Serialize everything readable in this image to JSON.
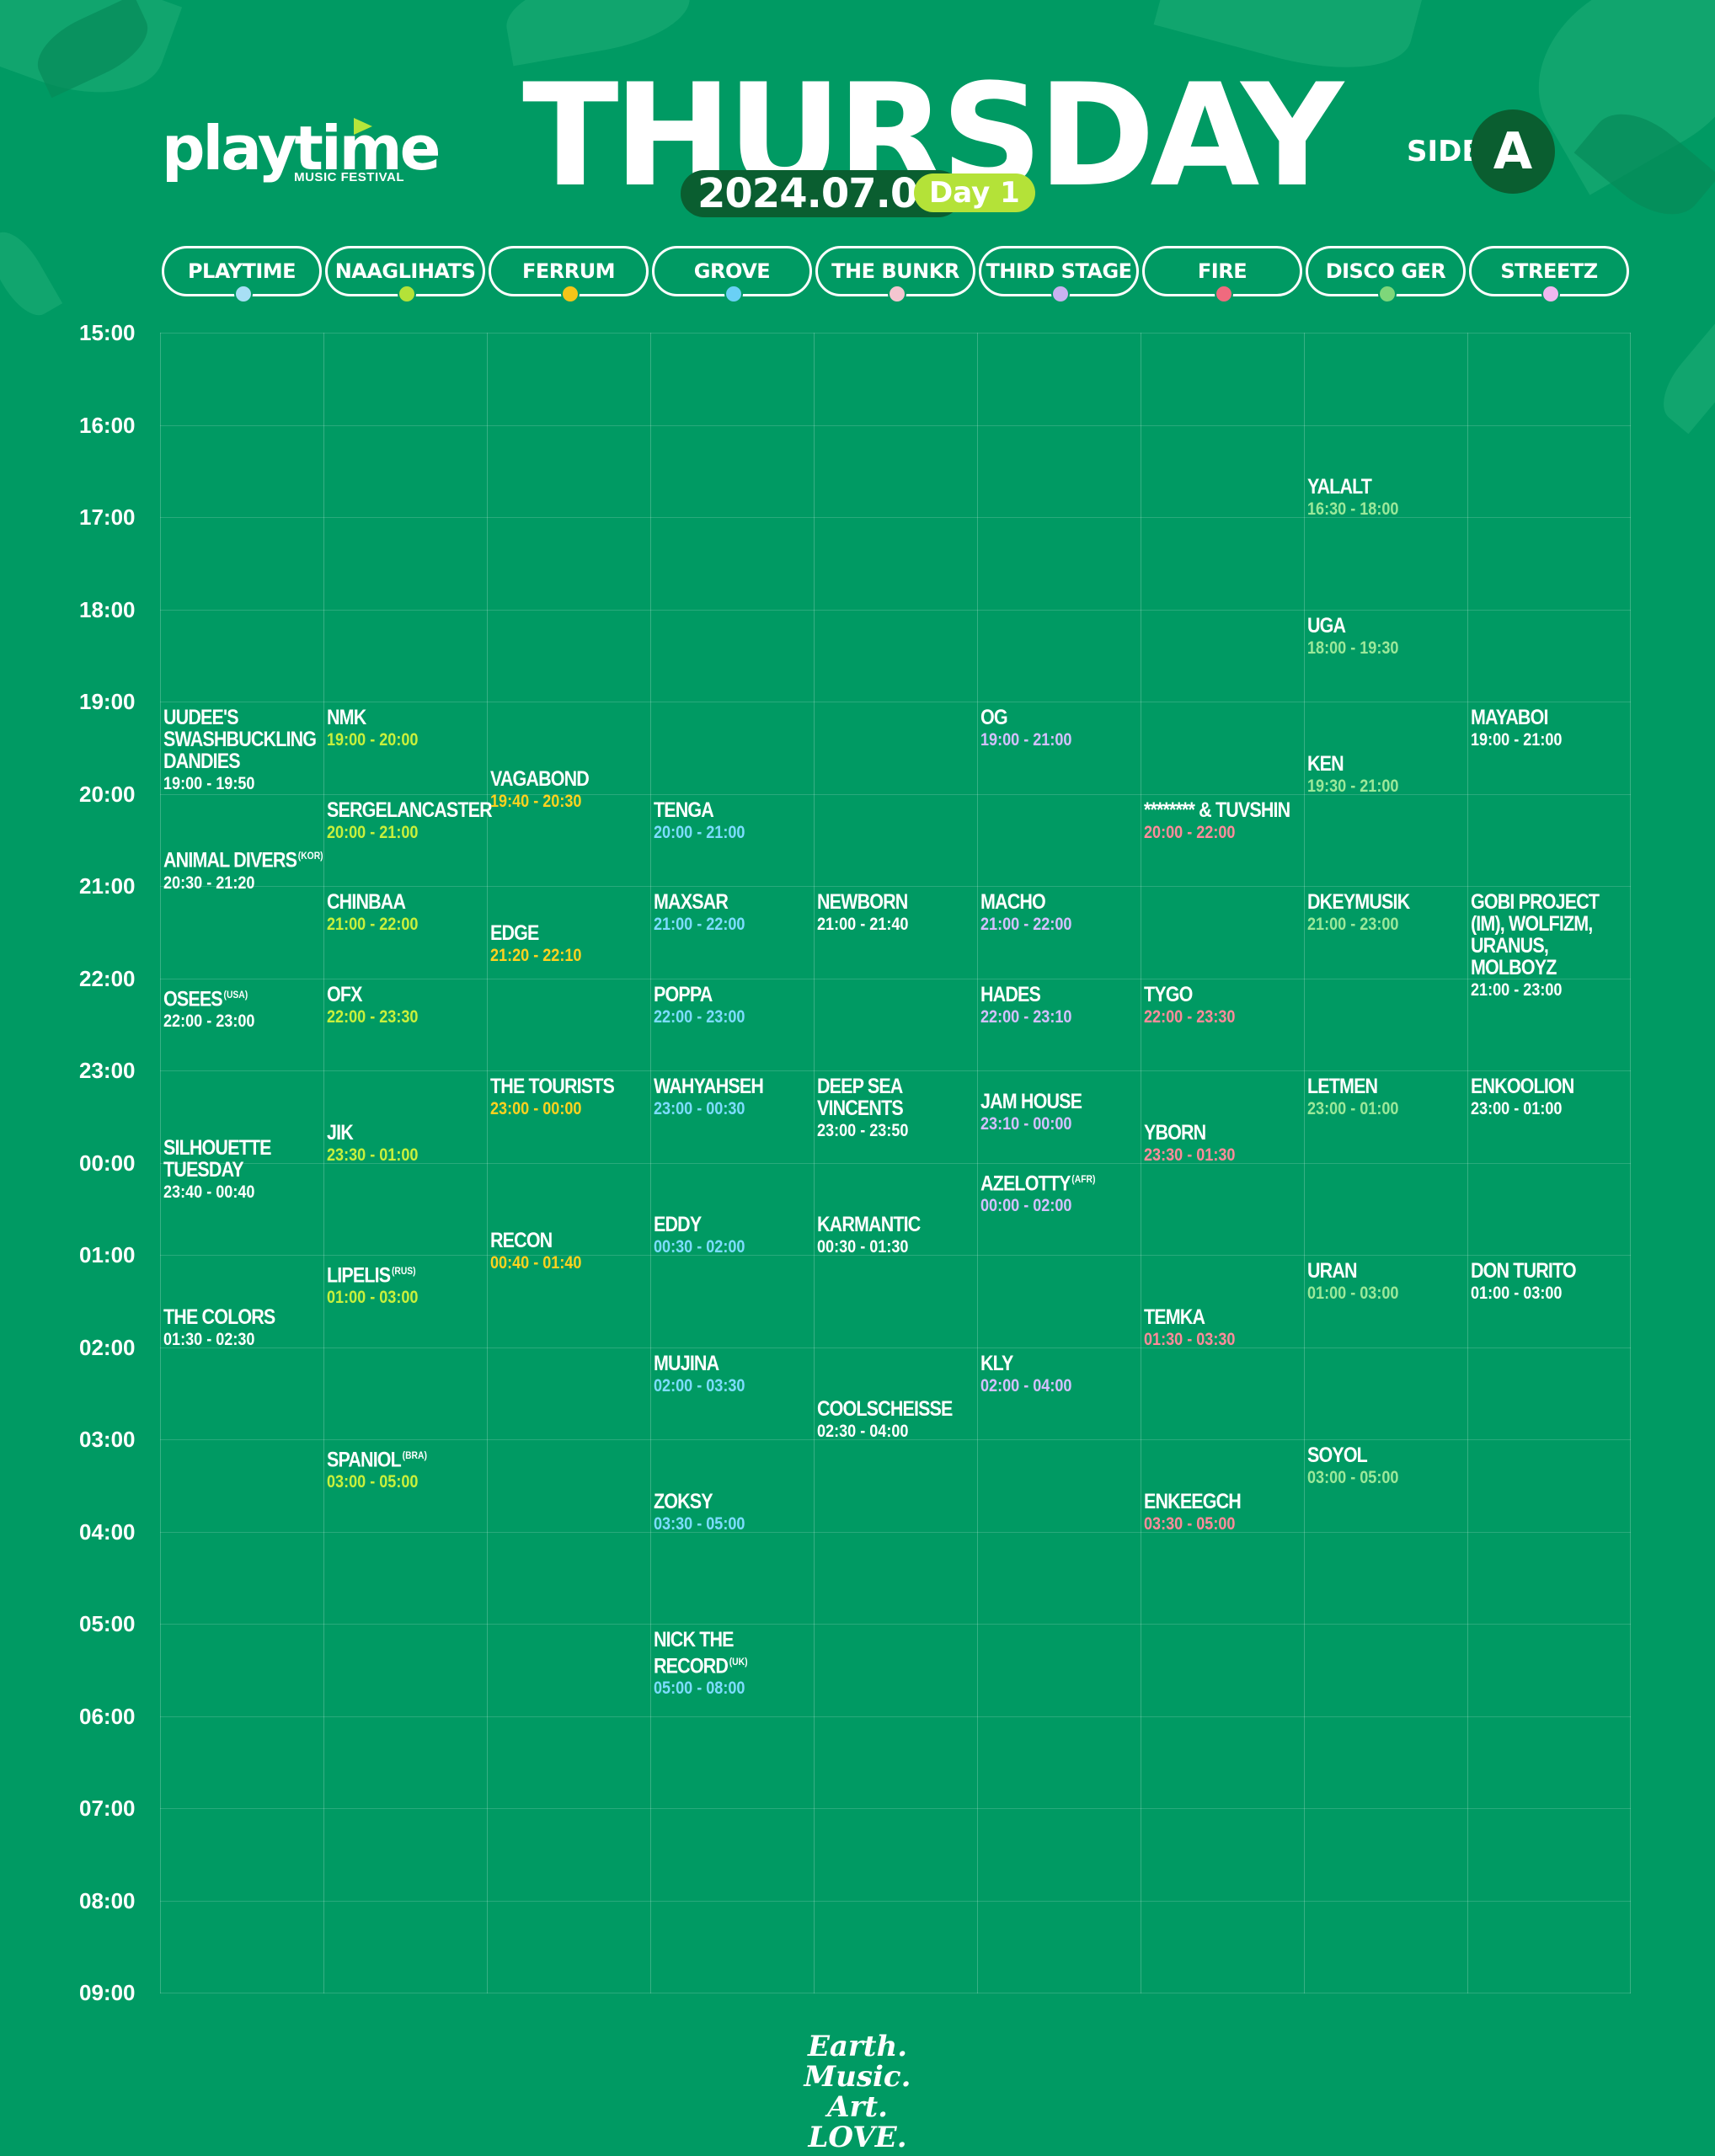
{
  "brand": {
    "logo_text": "playtime",
    "logo_sub": "MUSIC FESTIVAL"
  },
  "header": {
    "day": "THURSDAY",
    "date": "2024.07.04",
    "day_label": "Day 1",
    "side_label": "SIDE",
    "side_value": "A"
  },
  "colors": {
    "background": "#009a63",
    "accent_dark": "#0a5e30",
    "accent_lime": "#b4e238"
  },
  "times": [
    "15:00",
    "16:00",
    "17:00",
    "18:00",
    "19:00",
    "20:00",
    "21:00",
    "22:00",
    "23:00",
    "00:00",
    "01:00",
    "02:00",
    "03:00",
    "04:00",
    "05:00",
    "06:00",
    "07:00",
    "08:00",
    "09:00"
  ],
  "stages": [
    {
      "name": "PLAYTIME",
      "color": "#a8dff5",
      "range_color": "#ffffff",
      "acts": [
        {
          "name": "UUDEE'S SWASHBUCKLING DANDIES",
          "origin": "",
          "time": "19:00 - 19:50"
        },
        {
          "name": "ANIMAL DIVERS",
          "origin": "(KOR)",
          "time": "20:30 - 21:20"
        },
        {
          "name": "OSEES",
          "origin": "(USA)",
          "time": "22:00 - 23:00"
        },
        {
          "name": "SILHOUETTE TUESDAY",
          "origin": "",
          "time": "23:40 - 00:40"
        },
        {
          "name": "THE COLORS",
          "origin": "",
          "time": "01:30 - 02:30"
        }
      ]
    },
    {
      "name": "NAAGLIHATS",
      "color": "#b4e238",
      "range_color": "#c8f03c",
      "acts": [
        {
          "name": "NMK",
          "origin": "",
          "time": "19:00 - 20:00"
        },
        {
          "name": "SERGELANCASTER",
          "origin": "",
          "time": "20:00 - 21:00"
        },
        {
          "name": "CHINBAA",
          "origin": "",
          "time": "21:00 - 22:00"
        },
        {
          "name": "OFX",
          "origin": "",
          "time": "22:00 - 23:30"
        },
        {
          "name": "JIK",
          "origin": "",
          "time": "23:30 - 01:00"
        },
        {
          "name": "LIPELIS",
          "origin": "(RUS)",
          "time": "01:00 - 03:00"
        },
        {
          "name": "SPANIOL",
          "origin": "(BRA)",
          "time": "03:00 - 05:00"
        }
      ]
    },
    {
      "name": "FERRUM",
      "color": "#f5c518",
      "range_color": "#ffd21f",
      "acts": [
        {
          "name": "VAGABOND",
          "origin": "",
          "time": "19:40 - 20:30"
        },
        {
          "name": "EDGE",
          "origin": "",
          "time": "21:20 - 22:10"
        },
        {
          "name": "THE TOURISTS",
          "origin": "",
          "time": "23:00 - 00:00"
        },
        {
          "name": "RECON",
          "origin": "",
          "time": "00:40 - 01:40"
        }
      ]
    },
    {
      "name": "GROVE",
      "color": "#6ad0f5",
      "range_color": "#7ddcff",
      "acts": [
        {
          "name": "TENGA",
          "origin": "",
          "time": "20:00 - 21:00"
        },
        {
          "name": "MAXSAR",
          "origin": "",
          "time": "21:00 - 22:00"
        },
        {
          "name": "POPPA",
          "origin": "",
          "time": "22:00 - 23:00"
        },
        {
          "name": "WAHYAHSEH",
          "origin": "",
          "time": "23:00 - 00:30"
        },
        {
          "name": "EDDY",
          "origin": "",
          "time": "00:30 - 02:00"
        },
        {
          "name": "MUJINA",
          "origin": "",
          "time": "02:00 - 03:30"
        },
        {
          "name": "ZOKSY",
          "origin": "",
          "time": "03:30 - 05:00"
        },
        {
          "name": "NICK THE RECORD",
          "origin": "(UK)",
          "time": "05:00 - 08:00"
        }
      ]
    },
    {
      "name": "THE BUNKR",
      "color": "#f4c6d0",
      "range_color": "#ffffff",
      "acts": [
        {
          "name": "NEWBORN",
          "origin": "",
          "time": "21:00 - 21:40"
        },
        {
          "name": "DEEP SEA VINCENTS",
          "origin": "",
          "time": "23:00 - 23:50"
        },
        {
          "name": "KARMANTIC",
          "origin": "",
          "time": "00:30 - 01:30"
        },
        {
          "name": "COOLSCHEISSE",
          "origin": "",
          "time": "02:30 - 04:00"
        }
      ]
    },
    {
      "name": "THIRD STAGE",
      "color": "#c9b2f0",
      "range_color": "#d3c0ff",
      "acts": [
        {
          "name": "OG",
          "origin": "",
          "time": "19:00 - 21:00"
        },
        {
          "name": "MACHO",
          "origin": "",
          "time": "21:00 - 22:00"
        },
        {
          "name": "HADES",
          "origin": "",
          "time": "22:00 - 23:10"
        },
        {
          "name": "JAM HOUSE",
          "origin": "",
          "time": "23:10 - 00:00"
        },
        {
          "name": "AZELOTTY",
          "origin": "(AFR)",
          "time": "00:00 - 02:00"
        },
        {
          "name": "KLY",
          "origin": "",
          "time": "02:00 - 04:00"
        }
      ]
    },
    {
      "name": "FIRE",
      "color": "#f06a7e",
      "range_color": "#ff8b9b",
      "acts": [
        {
          "name": "******** & TUVSHIN",
          "origin": "",
          "time": "20:00 - 22:00"
        },
        {
          "name": "TYGO",
          "origin": "",
          "time": "22:00 - 23:30"
        },
        {
          "name": "YBORN",
          "origin": "",
          "time": "23:30 - 01:30"
        },
        {
          "name": "TEMKA",
          "origin": "",
          "time": "01:30 - 03:30"
        },
        {
          "name": "ENKEEGCH",
          "origin": "",
          "time": "03:30 - 05:00"
        }
      ]
    },
    {
      "name": "DISCO GER",
      "color": "#7ed77a",
      "range_color": "#9be89a",
      "acts": [
        {
          "name": "YALALT",
          "origin": "",
          "time": "16:30 - 18:00"
        },
        {
          "name": "UGA",
          "origin": "",
          "time": "18:00 - 19:30"
        },
        {
          "name": "KEN",
          "origin": "",
          "time": "19:30 - 21:00"
        },
        {
          "name": "DKEYMUSIK",
          "origin": "",
          "time": "21:00 - 23:00"
        },
        {
          "name": "LETMEN",
          "origin": "",
          "time": "23:00 - 01:00"
        },
        {
          "name": "URAN",
          "origin": "",
          "time": "01:00 - 03:00"
        },
        {
          "name": "SOYOL",
          "origin": "",
          "time": "03:00 - 05:00"
        }
      ]
    },
    {
      "name": "STREETZ",
      "color": "#f0b8f0",
      "range_color": "#ffffff",
      "acts": [
        {
          "name": "MAYABOI",
          "origin": "",
          "time": "19:00 - 21:00"
        },
        {
          "name": "GOBI PROJECT (IM), WOLFIZM, URANUS, MOLBOYZ",
          "origin": "",
          "time": "21:00 - 23:00"
        },
        {
          "name": "ENKOOLION",
          "origin": "",
          "time": "23:00 - 01:00"
        },
        {
          "name": "DON TURITO",
          "origin": "",
          "time": "01:00 - 03:00"
        }
      ]
    }
  ],
  "footer": {
    "line1": "Earth. Music.",
    "line2": "Art. LOVE."
  }
}
